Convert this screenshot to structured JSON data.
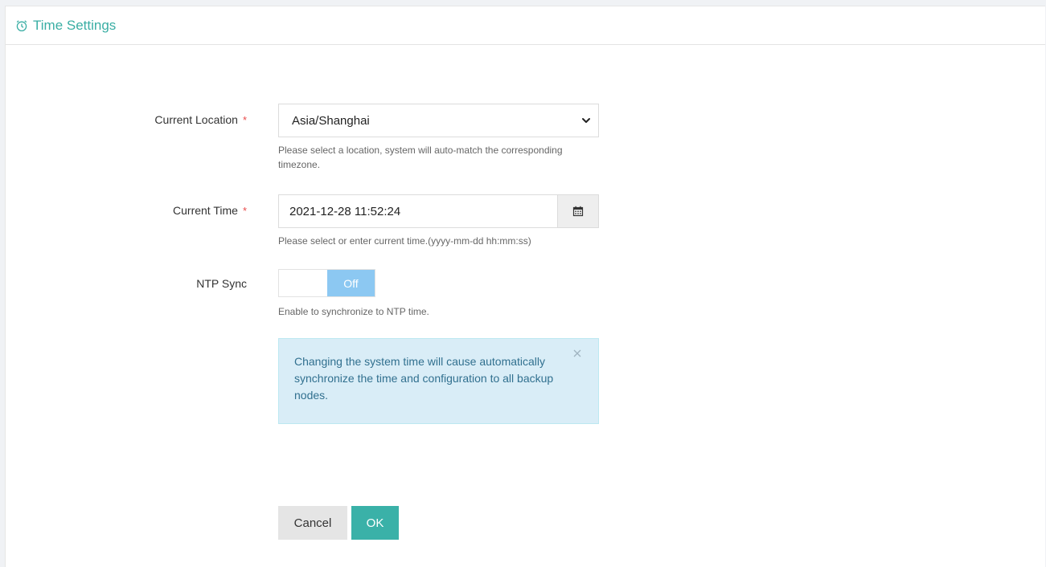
{
  "header": {
    "title": "Time Settings",
    "icon": "alarm-clock-icon"
  },
  "location": {
    "label": "Current Location",
    "required_mark": "*",
    "selected": "Asia/Shanghai",
    "help": "Please select a location, system will auto-match the corresponding timezone."
  },
  "time": {
    "label": "Current Time",
    "required_mark": "*",
    "value": "2021-12-28 11:52:24",
    "help": "Please select or enter current time.(yyyy-mm-dd hh:mm:ss)",
    "button_icon": "calendar-icon"
  },
  "ntp": {
    "label": "NTP Sync",
    "state": "Off",
    "enabled": false,
    "help": "Enable to synchronize to NTP time."
  },
  "alert": {
    "message": "Changing the system time will cause automatically synchronize the time and configuration to all backup nodes.",
    "close_icon": "close-icon"
  },
  "actions": {
    "cancel_label": "Cancel",
    "ok_label": "OK"
  },
  "colors": {
    "accent": "#3ab1a8",
    "required": "#e94b4b",
    "toggle_off": "#8cc8f2",
    "alert_bg": "#d9edf7",
    "alert_text": "#31708f"
  }
}
